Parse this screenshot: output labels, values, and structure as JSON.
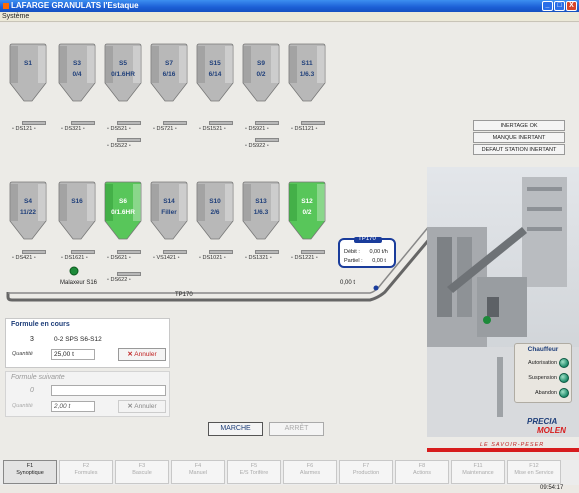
{
  "window": {
    "title": "LAFARGE GRANULATS l'Estaque",
    "menu_label": "Système",
    "minimize": "_",
    "maximize": "□",
    "close": "X"
  },
  "silos_row1": [
    {
      "name": "S1",
      "formula": ""
    },
    {
      "name": "S3",
      "formula": "0/4"
    },
    {
      "name": "S5",
      "formula": "0/1.6HR"
    },
    {
      "name": "S7",
      "formula": "6/16"
    },
    {
      "name": "S15",
      "formula": "6/14"
    },
    {
      "name": "S9",
      "formula": "0/2"
    },
    {
      "name": "S11",
      "formula": "1/6.3"
    }
  ],
  "ds_row1": [
    "DS121",
    "DS321",
    "DS521",
    "DS721",
    "DS1521",
    "DS921",
    "DS1121"
  ],
  "ds_row1b": [
    "DS522",
    "DS922"
  ],
  "silos_row2": [
    {
      "name": "S4",
      "formula": "11/22",
      "color": "#2f5fb0"
    },
    {
      "name": "S16",
      "formula": "",
      "color": "#2f5fb0"
    },
    {
      "name": "S6",
      "formula": "0/1.6HR",
      "color": "#46c04a"
    },
    {
      "name": "S14",
      "formula": "Filler",
      "color": "#2f5fb0"
    },
    {
      "name": "S10",
      "formula": "2/6",
      "color": "#2f5fb0"
    },
    {
      "name": "S13",
      "formula": "1/6.3",
      "color": "#2f5fb0"
    },
    {
      "name": "S12",
      "formula": "0/2",
      "color": "#46c04a"
    }
  ],
  "ds_row2": [
    "DS421",
    "DS1621",
    "DS621",
    "VS1421",
    "DS1021",
    "DS1321",
    "DS1221"
  ],
  "ds_row2b": [
    "DS622"
  ],
  "malaxeur_label": "Malaxeur S16",
  "conveyor": {
    "label": "TP170",
    "weight": "0,00 t"
  },
  "tp_box": {
    "title": "TP170",
    "debit_label": "Débit :",
    "debit_value": "0,00 t/h",
    "partiel_label": "Partiel :",
    "partiel_value": "0,00 t"
  },
  "status_buttons": [
    "INERTAGE OK",
    "MANQUE INERTANT",
    "DEFAUT STATION INERTANT"
  ],
  "formule_en_cours": {
    "title": "Formule en cours",
    "number": "3",
    "name": "0-2 SPS S6-S12",
    "quantite_label": "Quantité",
    "quantite_value": "25,00 t",
    "annuler": "Annuler"
  },
  "formule_suivante": {
    "title": "Formule suivante",
    "number": "0",
    "name": "",
    "quantite_label": "Quantité",
    "quantite_value": "2,00 t",
    "annuler": "Annuler"
  },
  "actions": {
    "marche": "MARCHE",
    "arret": "ARRÊT"
  },
  "chauffeur": {
    "title": "Chauffeur",
    "items": [
      "Autorisation",
      "Suspension",
      "Abandon"
    ]
  },
  "logo": {
    "line1": "PRECIA",
    "line2": "MOLEN",
    "slogan": "LE SAVOIR-PESER"
  },
  "fkeys": [
    {
      "key": "F1",
      "label": "Synoptique",
      "active": true
    },
    {
      "key": "F2",
      "label": "Formules"
    },
    {
      "key": "F3",
      "label": "Bascule"
    },
    {
      "key": "F4",
      "label": "Manuel"
    },
    {
      "key": "F5",
      "label": "E/S Torifère"
    },
    {
      "key": "F6",
      "label": "Alarmes"
    },
    {
      "key": "F7",
      "label": "Production"
    },
    {
      "key": "F8",
      "label": "Actions"
    },
    {
      "key": "F11",
      "label": "Maintenance"
    },
    {
      "key": "F12",
      "label": "Mise en Service"
    }
  ],
  "clock": "09:54:17"
}
